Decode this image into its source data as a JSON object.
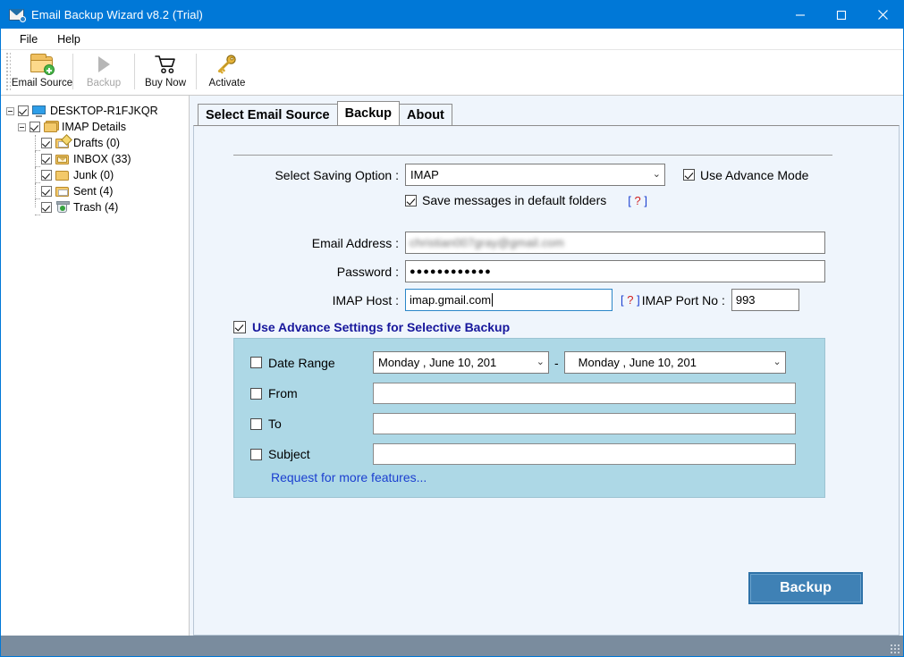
{
  "window": {
    "title": "Email Backup Wizard v8.2 (Trial)",
    "icon": "mail-backup-icon",
    "minimize": "–",
    "maximize": "□",
    "close": "✕",
    "accent_color": "#0078D7",
    "statusbar_color": "#7A8C9E"
  },
  "menu": {
    "items": [
      "File",
      "Help"
    ]
  },
  "toolbar": {
    "buttons": [
      {
        "label": "Email Source",
        "icon": "folder-add-icon",
        "enabled": true
      },
      {
        "label": "Backup",
        "icon": "play-icon",
        "enabled": false
      },
      {
        "label": "Buy Now",
        "icon": "shopping-cart-icon",
        "enabled": true
      },
      {
        "label": "Activate",
        "icon": "key-icon",
        "enabled": true
      }
    ]
  },
  "sidebar": {
    "tree": [
      {
        "label": "DESKTOP-R1FJKQR",
        "icon": "computer-icon",
        "checked": true,
        "level": 0,
        "expanded": true
      },
      {
        "label": "IMAP Details",
        "icon": "folder-stack-icon",
        "checked": true,
        "level": 1,
        "expanded": true
      },
      {
        "label": "Drafts (0)",
        "icon": "drafts-folder-icon",
        "checked": true,
        "level": 2
      },
      {
        "label": "INBOX (33)",
        "icon": "inbox-folder-icon",
        "checked": true,
        "level": 2
      },
      {
        "label": "Junk (0)",
        "icon": "junk-folder-icon",
        "checked": true,
        "level": 2
      },
      {
        "label": "Sent (4)",
        "icon": "sent-folder-icon",
        "checked": true,
        "level": 2
      },
      {
        "label": "Trash (4)",
        "icon": "trash-folder-icon",
        "checked": true,
        "level": 2
      }
    ]
  },
  "tabs": [
    {
      "label": "Select Email Source",
      "active": false
    },
    {
      "label": "Backup",
      "active": true
    },
    {
      "label": "About",
      "active": false
    }
  ],
  "form": {
    "saving_option_label": "Select Saving Option :",
    "saving_option_value": "IMAP",
    "saving_option_items": [
      "IMAP"
    ],
    "use_advance_mode_label": "Use Advance Mode",
    "use_advance_mode_checked": true,
    "save_default_folders_label": "Save messages in default folders",
    "save_default_folders_checked": true,
    "help_bracket_open": "[",
    "help_question": "?",
    "help_bracket_close": "]",
    "email_label": "Email Address :",
    "email_value": "christian007gray@gmail.com",
    "email_redacted": true,
    "password_label": "Password :",
    "password_value": "●●●●●●●●●●●●",
    "imap_host_label": "IMAP Host :",
    "imap_host_value": "imap.gmail.com",
    "imap_port_label": "IMAP Port No :",
    "imap_port_value": "993"
  },
  "advance": {
    "header_label": "Use Advance Settings for Selective Backup",
    "header_checked": true,
    "date_range_label": "Date Range",
    "date_range_checked": false,
    "date_from_value": "Monday   ,     June      10, 201",
    "date_to_value": "Monday   ,     June      10, 201",
    "date_separator": "-",
    "from_label": "From",
    "from_checked": false,
    "from_value": "",
    "to_label": "To",
    "to_checked": false,
    "to_value": "",
    "subject_label": "Subject",
    "subject_checked": false,
    "subject_value": "",
    "request_link": "Request for more features..."
  },
  "actions": {
    "backup_button": "Backup"
  }
}
